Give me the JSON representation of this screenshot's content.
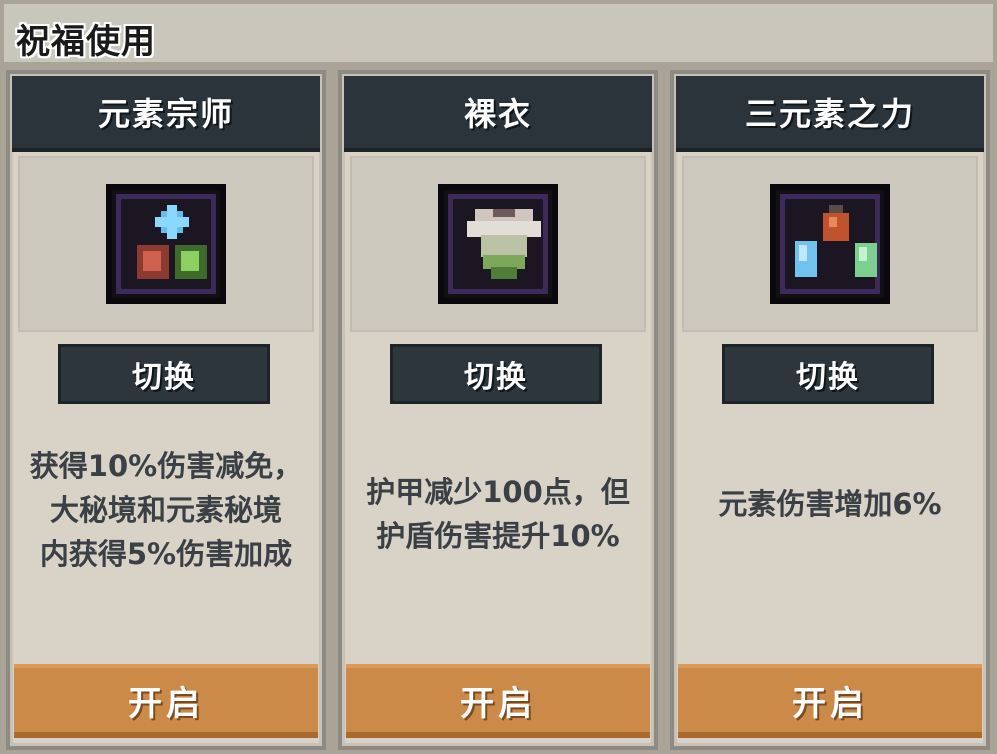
{
  "window": {
    "title": "祝福使用"
  },
  "cards": [
    {
      "name": "元素宗师",
      "icon": "elemental-master-icon",
      "swap_label": "切换",
      "description": "获得10%伤害减免，\n大秘境和元素秘境\n内获得5%伤害加成",
      "open_label": "开启"
    },
    {
      "name": "裸衣",
      "icon": "bare-armor-icon",
      "swap_label": "切换",
      "description": "护甲减少100点，但\n护盾伤害提升10%",
      "open_label": "开启"
    },
    {
      "name": "三元素之力",
      "icon": "three-elements-power-icon",
      "swap_label": "切换",
      "description": "元素伤害增加6%",
      "open_label": "开启"
    }
  ],
  "colors": {
    "header_bg": "#2a343a",
    "card_bg": "#d8d3c6",
    "open_button": "#cc8a48",
    "text_dark": "#3b4046"
  }
}
